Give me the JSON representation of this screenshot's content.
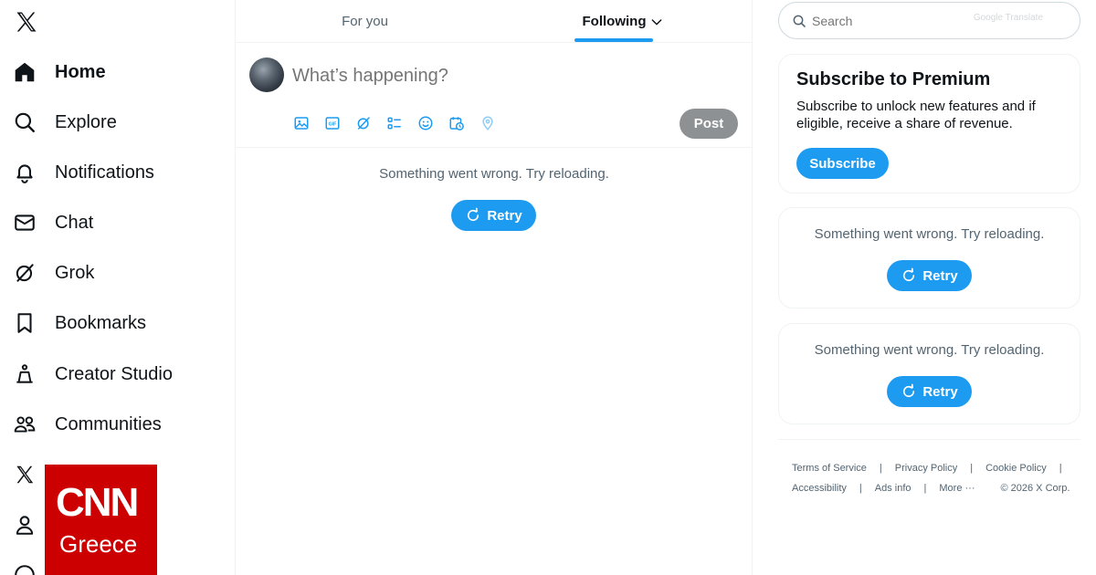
{
  "sidebar": {
    "items": [
      {
        "label": "Home",
        "icon": "home-icon"
      },
      {
        "label": "Explore",
        "icon": "search-icon"
      },
      {
        "label": "Notifications",
        "icon": "bell-icon"
      },
      {
        "label": "Chat",
        "icon": "mail-icon"
      },
      {
        "label": "Grok",
        "icon": "grok-icon"
      },
      {
        "label": "Bookmarks",
        "icon": "bookmark-icon"
      },
      {
        "label": "Creator Studio",
        "icon": "creator-studio-icon"
      },
      {
        "label": "Communities",
        "icon": "communities-icon"
      },
      {
        "label": "",
        "icon": "x-premium-icon"
      },
      {
        "label": "",
        "icon": "profile-icon"
      }
    ]
  },
  "watermark": {
    "logo_text": "CNN",
    "subtitle": "Greece"
  },
  "tabs": [
    {
      "label": "For you",
      "active": false
    },
    {
      "label": "Following",
      "active": true
    }
  ],
  "composer": {
    "placeholder": "What’s happening?",
    "post_label": "Post",
    "tools": [
      "image-icon",
      "gif-icon",
      "grok-icon",
      "poll-icon",
      "emoji-icon",
      "schedule-icon",
      "location-icon"
    ]
  },
  "feed": {
    "error_text": "Something went wrong. Try reloading.",
    "retry_label": "Retry"
  },
  "search": {
    "placeholder": "Search",
    "overlay_text": "Google Translate"
  },
  "premium": {
    "title": "Subscribe to Premium",
    "text": "Subscribe to unlock new features and if eligible, receive a share of revenue.",
    "button": "Subscribe"
  },
  "widgets": [
    {
      "error_text": "Something went wrong. Try reloading.",
      "retry_label": "Retry"
    },
    {
      "error_text": "Something went wrong. Try reloading.",
      "retry_label": "Retry"
    }
  ],
  "footer": {
    "row1": [
      "Terms of Service",
      "Privacy Policy",
      "Cookie Policy"
    ],
    "row2": [
      "Accessibility",
      "Ads info",
      "More ···"
    ],
    "copyright": "© 2026 X Corp."
  },
  "colors": {
    "accent": "#1d9bf0",
    "text_primary": "#0f1419",
    "text_secondary": "#536471",
    "border": "#eff3f4",
    "post_disabled": "#8e9194",
    "cnn_red": "#cc0000"
  }
}
